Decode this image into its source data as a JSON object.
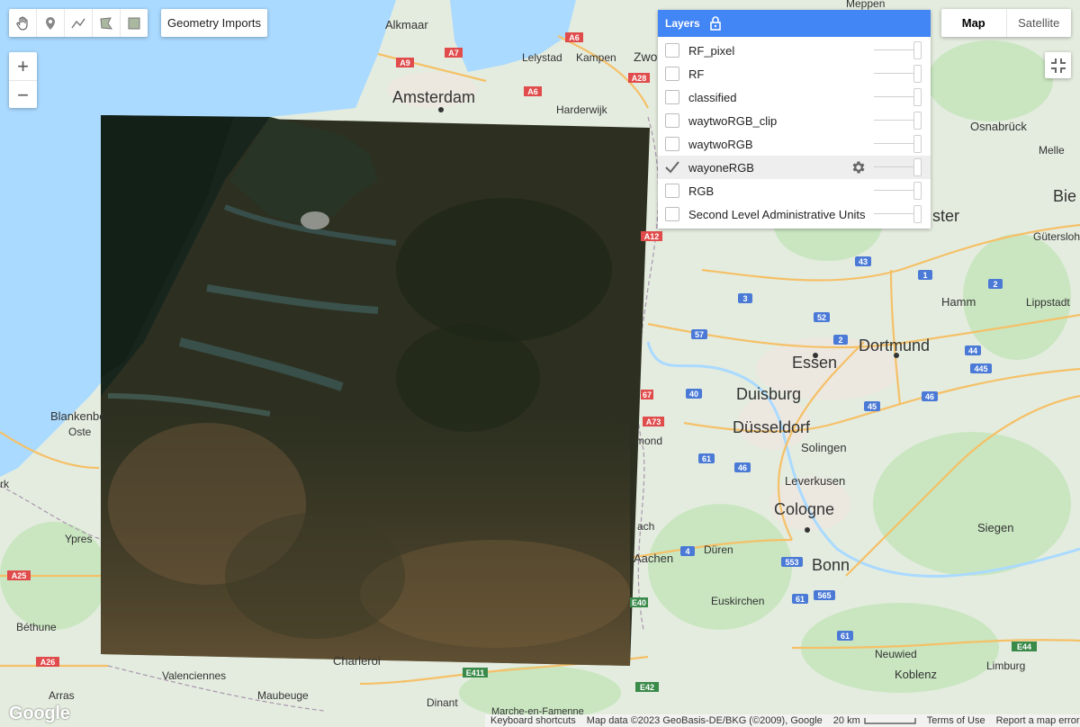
{
  "toolbar": {
    "tools": [
      {
        "name": "pan-hand-icon",
        "title": "pan"
      },
      {
        "name": "point-marker-icon",
        "title": "point"
      },
      {
        "name": "line-icon",
        "title": "line"
      },
      {
        "name": "polygon-icon",
        "title": "polygon"
      },
      {
        "name": "rectangle-icon",
        "title": "rectangle"
      }
    ],
    "geometry_imports_label": "Geometry Imports"
  },
  "zoom": {
    "in_label": "+",
    "out_label": "−"
  },
  "map_type": {
    "map_label": "Map",
    "satellite_label": "Satellite",
    "active": "Map"
  },
  "layers": {
    "title": "Layers",
    "items": [
      {
        "label": "RF_pixel",
        "checked": false
      },
      {
        "label": "RF",
        "checked": false
      },
      {
        "label": "classified",
        "checked": false
      },
      {
        "label": "waytwoRGB_clip",
        "checked": false
      },
      {
        "label": "waytwoRGB",
        "checked": false
      },
      {
        "label": "wayoneRGB",
        "checked": true
      },
      {
        "label": "RGB",
        "checked": false
      },
      {
        "label": "Second Level Administrative Units",
        "checked": false
      }
    ]
  },
  "places": {
    "alkmaar": "Alkmaar",
    "amsterdam": "Amsterdam",
    "lelystad": "Lelystad",
    "kampen": "Kampen",
    "zwolle": "Zwo",
    "meppen": "Meppen",
    "harderwijk": "Harderwijk",
    "osnabruck": "Osnabrück",
    "melle": "Melle",
    "bielefeld": "Bie",
    "munster": "ster",
    "gutersloh": "Gütersloh",
    "hamm": "Hamm",
    "lippstadt": "Lippstadt",
    "dortmund": "Dortmund",
    "essen": "Essen",
    "duisburg": "Duisburg",
    "dusseldorf": "Düsseldorf",
    "solingen": "Solingen",
    "leverkusen": "Leverkusen",
    "cologne": "Cologne",
    "siegen": "Siegen",
    "duren": "Düren",
    "bonn": "Bonn",
    "euskirchen": "Euskirchen",
    "neuwied": "Neuwied",
    "koblenz": "Koblenz",
    "limburg": "Limburg",
    "aachen": "Aachen",
    "mond": "mond",
    "blankenberge": "Blankenbe",
    "oostende": "Oste",
    "ypres": "Ypres",
    "bethune": "Béthune",
    "valenciennes": "Valenciennes",
    "arras": "Arras",
    "charleroi": "Charleroi",
    "maubeuge": "Maubeuge",
    "dinant": "Dinant",
    "marche": "Marche-en-Famenne",
    "rk": "rk",
    "ach": "ach"
  },
  "road_labels": {
    "a9": "A9",
    "a7": "A7",
    "a6a": "A6",
    "a6b": "A6",
    "a28": "A28",
    "a12": "A12",
    "n43": "43",
    "n1": "1",
    "n2": "2",
    "n3": "3",
    "n52": "52",
    "n57": "57",
    "n2b": "2",
    "n44": "44",
    "n445": "445",
    "n46": "46",
    "n40": "40",
    "n67": "67",
    "a73": "A73",
    "n61a": "61",
    "n46b": "46",
    "n4": "4",
    "n553": "553",
    "n61b": "61",
    "n565": "565",
    "n61c": "61",
    "n45": "45",
    "e44": "E44",
    "a25": "A25",
    "a26": "A26",
    "e411": "E411",
    "e42": "E42",
    "e40": "E40"
  },
  "footer": {
    "keyboard_shortcuts": "Keyboard shortcuts",
    "map_data": "Map data ©2023 GeoBasis-DE/BKG (©2009), Google",
    "scale": "20 km",
    "terms": "Terms of Use",
    "report": "Report a map error"
  },
  "google_logo": "Google",
  "colors": {
    "accent": "#4285f4",
    "land": "#e8eee2",
    "water": "#aadaff",
    "forest": "#c5e5bd",
    "motorway": "#f5b95b",
    "urban": "#eceae4"
  }
}
